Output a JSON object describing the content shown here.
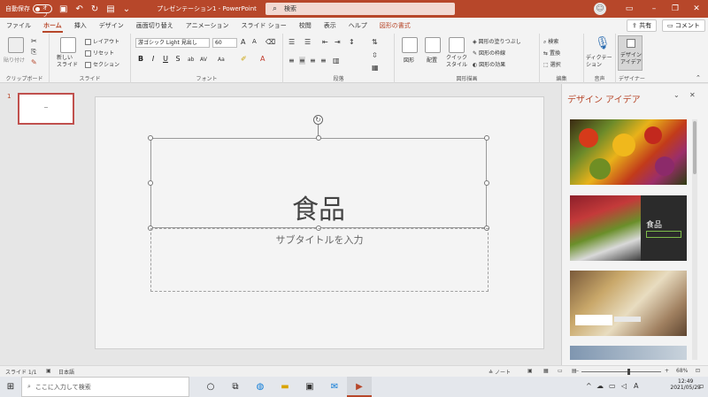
{
  "titlebar": {
    "autosave_label": "自動保存",
    "autosave_state": "オフ",
    "doc_title": "プレゼンテーション1 - PowerPoint",
    "search_placeholder": "検索",
    "window_controls": [
      "minimize-icon",
      "restore-icon",
      "close-icon"
    ]
  },
  "tabs": [
    "ファイル",
    "ホーム",
    "挿入",
    "デザイン",
    "画面切り替え",
    "アニメーション",
    "スライド ショー",
    "校閲",
    "表示",
    "ヘルプ",
    "図形の書式"
  ],
  "active_tab": "ホーム",
  "share_label": "共有",
  "comment_label": "コメント",
  "ribbon": {
    "clipboard": {
      "paste": "貼り付け",
      "label": "クリップボード"
    },
    "slides": {
      "new_slide": "新しい\nスライド",
      "layout": "レイアウト",
      "reset": "リセット",
      "section": "セクション",
      "label": "スライド"
    },
    "font": {
      "font_name": "游ゴシック Light 見出し",
      "font_size": "60",
      "bold": "B",
      "italic": "I",
      "underline": "U",
      "strike": "S",
      "label": "フォント"
    },
    "paragraph": {
      "label": "段落"
    },
    "drawing": {
      "shapes": "図形",
      "arrange": "配置",
      "quick_styles": "クイック\nスタイル",
      "fill": "図形の塗りつぶし",
      "outline": "図形の枠線",
      "effects": "図形の効果",
      "label": "図形描画"
    },
    "editing": {
      "find": "検索",
      "replace": "置換",
      "select": "選択",
      "label": "編集"
    },
    "voice": {
      "dictate": "ディクテー\nション",
      "label": "音声"
    },
    "designer": {
      "design_ideas": "デザイン\nアイデア",
      "label": "デザイナー"
    }
  },
  "thumbnails": [
    {
      "number": "1"
    }
  ],
  "slide": {
    "title": "食品",
    "subtitle_placeholder": "サブタイトルを入力"
  },
  "design_pane": {
    "title": "デザイン アイデア",
    "idea2_title": "食品"
  },
  "statusbar": {
    "slide_count": "スライド 1/1",
    "language": "日本語",
    "notes": "ノート",
    "zoom": "68%"
  },
  "taskbar": {
    "search_placeholder": "ここに入力して検索",
    "time": "12:49",
    "date": "2021/05/23",
    "ime": "A"
  }
}
